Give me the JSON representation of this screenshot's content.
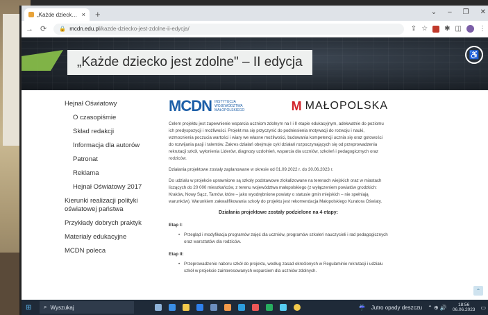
{
  "browser": {
    "tab_title": "„Każde dziecko jest zdolne\" – II e",
    "tab_close": "×",
    "new_tab": "+",
    "url_host": "mcdn.edu.pl",
    "url_path": "/kazde-dziecko-jest-zdolne-ii-edycja/"
  },
  "hero": {
    "title": "„Każde dziecko jest zdolne\" – II edycja"
  },
  "sidebar": {
    "items": [
      {
        "label": "Hejnał Oświatowy",
        "sub": false
      },
      {
        "label": "O czasopiśmie",
        "sub": true
      },
      {
        "label": "Skład redakcji",
        "sub": true
      },
      {
        "label": "Informacja dla autorów",
        "sub": true
      },
      {
        "label": "Patronat",
        "sub": true
      },
      {
        "label": "Reklama",
        "sub": true
      },
      {
        "label": "Hejnał Oświatowy 2017",
        "sub": true
      },
      {
        "label": "Kierunki realizacji polityki oświatowej państwa",
        "sub": false
      },
      {
        "label": "Przykłady dobrych praktyk",
        "sub": false
      },
      {
        "label": "Materiały edukacyjne",
        "sub": false
      },
      {
        "label": "MCDN poleca",
        "sub": false
      }
    ]
  },
  "logos": {
    "mcdn": "MCDN",
    "mcdn_sub": "INSTYTUCJA WOJEWÓDZTWA MAŁOPOLSKIEGO",
    "malopolska": "MAŁOPOLSKA"
  },
  "main": {
    "p1": "Celem projektu jest zapewnienie wsparcia uczniom zdolnym na I i II etapie edukacyjnym, adekwatnie do poziomu ich predyspozycji i możliwości. Projekt ma się przyczynić do podniesienia motywacji do rozwoju i nauki, wzmocnienia poczucia wartości i wiary we własne możliwości, budowania kompetencji ucznia się oraz gotowości do rozwijania pasji i talentów. Zakres działań obejmuje cykl działań rozpoczynających się od przeprowadzenia rekrutacji szkół, wyłonienia Liderów, diagnozy uzdolnień, wsparcia dla uczniów, szkoleń i pedagogicznych oraz rodziców.",
    "p2": "Działania projektowe zostały zaplanowane w okresie od 01.09.2022 r. do 30.06.2023 r.",
    "p3": "Do udziału w projekcie uprawnione są szkoły podstawowe zlokalizowane na terenach wiejskich oraz w miastach liczących do 20 000 mieszkańców, z terenu województwa małopolskiego (z wyłączeniem powiatów grodzkich: Kraków, Nowy Sącz, Tarnów, które – jako wyodrębnione powiaty o statusie gmin miejskich – nie spełniają warunków). Warunkiem zakwalifikowania szkoły do projektu jest rekomendacja Małopolskiego Kuratora Oświaty.",
    "heading": "Działania projektowe zostały podzielone na 4 etapy:",
    "etap1": "Etap I:",
    "etap1_bullet": "Przegląd i modyfikacja programów zajęć dla uczniów, programów szkoleń nauczycieli i rad pedagogicznych oraz warsztatów dla rodziców.",
    "etap2": "Etap II:",
    "etap2_bullet": "Przeprowadzenie naboru szkół do projektu, według zasad określonych w Regulaminie rekrutacji i udziału szkół w projekcie zainteresowanych wsparciem dla uczniów zdolnych."
  },
  "taskbar": {
    "search_placeholder": "Wyszukaj",
    "weather": "Jutro opady deszczu",
    "time": "18:56",
    "date": "06.06.2023"
  }
}
